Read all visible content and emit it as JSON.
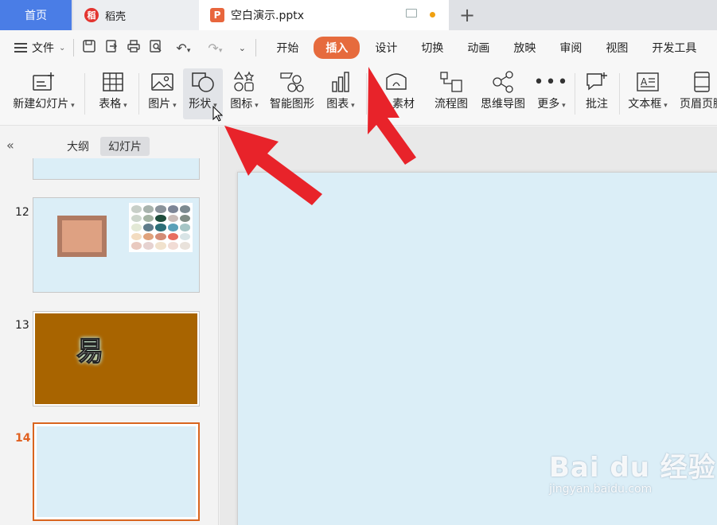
{
  "tabs": [
    {
      "label": "首页"
    },
    {
      "label": "稻壳",
      "logo": "稻"
    },
    {
      "label": "空白演示.pptx",
      "logo": "P"
    }
  ],
  "menu": {
    "file": "文件",
    "tabs": [
      "开始",
      "插入",
      "设计",
      "切换",
      "动画",
      "放映",
      "审阅",
      "视图",
      "开发工具"
    ],
    "active": "插入"
  },
  "ribbon": {
    "new_slide": "新建幻灯片",
    "table": "表格",
    "picture": "图片",
    "shape": "形状",
    "icon": "图标",
    "smart_graphic": "智能图形",
    "chart": "图表",
    "material": "素材",
    "flowchart": "流程图",
    "mindmap": "思维导图",
    "more": "更多",
    "comment": "批注",
    "textbox": "文本框",
    "header_footer": "页眉页脚"
  },
  "panel": {
    "view_tabs": [
      "大纲",
      "幻灯片"
    ],
    "active_view": "幻灯片",
    "slides": [
      {
        "number": "12"
      },
      {
        "number": "13",
        "text": "易"
      },
      {
        "number": "14",
        "current": true
      }
    ]
  },
  "colors": {
    "accent": "#e66b3d",
    "home_tab": "#4a7de6",
    "slide_bg": "#dbeef7",
    "slide13_bg": "#a86400",
    "arrow": "#e8232a"
  },
  "swatches": [
    "#c8cfc8",
    "#a8b3ad",
    "#8a939b",
    "#7d8596",
    "#7c8a90",
    "#cdd6cc",
    "#a4b3a3",
    "#1f4d3c",
    "#c9bcb8",
    "#7f8c84",
    "#e3e9d6",
    "#5f7b8a",
    "#2c6e77",
    "#5aa0b8",
    "#a6c6c6",
    "#f3dcc0",
    "#e0a27c",
    "#d48c76",
    "#e86e60",
    "#d8e4e6",
    "#e9c9bf",
    "#e6d2d0",
    "#f1e2cd",
    "#f1dcd5",
    "#e9e2db"
  ],
  "watermark": {
    "main": "Bai du 经验",
    "sub": "jingyan.baidu.com"
  }
}
